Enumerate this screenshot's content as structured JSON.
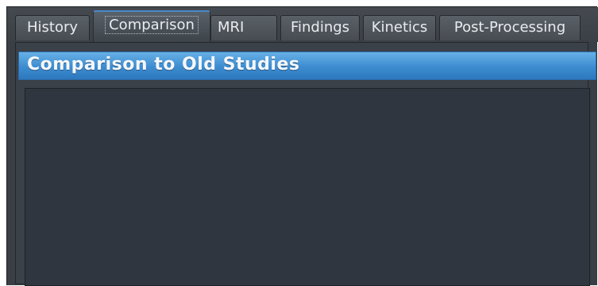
{
  "tabs": [
    {
      "label": "History",
      "active": false
    },
    {
      "label": "Comparison",
      "active": true
    },
    {
      "label": "MRI",
      "active": false
    },
    {
      "label": "Findings",
      "active": false
    },
    {
      "label": "Kinetics",
      "active": false
    },
    {
      "label": "Post-Processing",
      "active": false
    }
  ],
  "section": {
    "title": "Comparison to Old Studies"
  },
  "colors": {
    "header_blue": "#3d8cd0",
    "active_tab_accent": "#4b89c9",
    "content_bg": "#2f3640"
  }
}
